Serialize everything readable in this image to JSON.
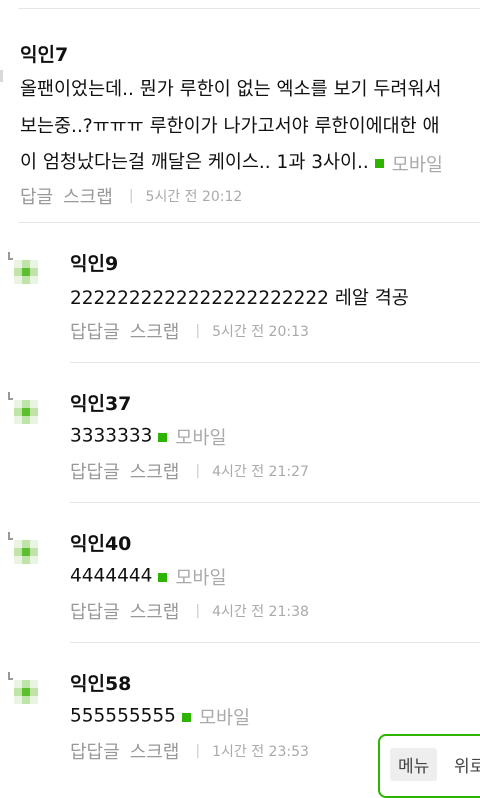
{
  "comments": [
    {
      "author": "익인7",
      "lines": [
        "올팬이었는데.. 뭔가 루한이 없는 엑소를 보기 두려워서",
        "보는중..?ㅠㅠㅠ 루한이가 나가고서야 루한이에대한 애",
        "이 엄청났다는걸 깨달은 케이스.. 1과 3사이.."
      ],
      "mobile": "모바일",
      "actions": [
        "답글",
        "스크랩"
      ],
      "time": "5시간 전 20:12"
    },
    {
      "author": "익인9",
      "text": "2222222222222222222222 레알 격공",
      "actions": [
        "답답글",
        "스크랩"
      ],
      "time": "5시간 전 20:13"
    },
    {
      "author": "익인37",
      "text": "3333333",
      "mobile": "모바일",
      "actions": [
        "답답글",
        "스크랩"
      ],
      "time": "4시간 전 21:27"
    },
    {
      "author": "익인40",
      "text": "4444444",
      "mobile": "모바일",
      "actions": [
        "답답글",
        "스크랩"
      ],
      "time": "4시간 전 21:38"
    },
    {
      "author": "익인58",
      "text": "555555555",
      "mobile": "모바일",
      "actions": [
        "답답글",
        "스크랩"
      ],
      "time": "1시간 전 23:53"
    }
  ],
  "floating": {
    "menu": "메뉴",
    "up": "위로"
  },
  "colors": {
    "accent": "#2db400",
    "muted": "#999999"
  }
}
